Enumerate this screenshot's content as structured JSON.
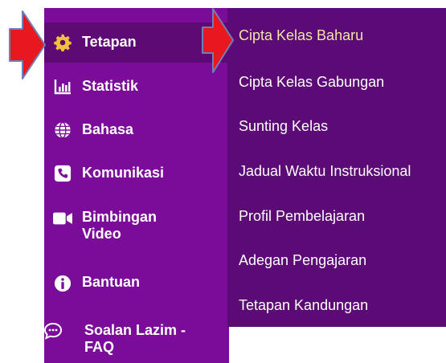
{
  "sidebar": {
    "items": [
      {
        "label": "Tetapan",
        "icon": "gear-icon",
        "active": true
      },
      {
        "label": "Statistik",
        "icon": "bar-chart-icon"
      },
      {
        "label": "Bahasa",
        "icon": "globe-icon"
      },
      {
        "label": "Komunikasi",
        "icon": "phone-icon"
      },
      {
        "label_line1": "Bimbingan",
        "label_line2": "Video",
        "icon": "video-camera-icon"
      },
      {
        "label": "Bantuan",
        "icon": "info-icon"
      },
      {
        "label_line1": "Soalan Lazim -",
        "label_line2": "FAQ",
        "icon": "chat-bubble-icon"
      }
    ]
  },
  "submenu": {
    "items": [
      {
        "label": "Cipta Kelas Baharu",
        "highlight": true
      },
      {
        "label": "Cipta Kelas Gabungan"
      },
      {
        "label": "Sunting Kelas"
      },
      {
        "label": "Jadual Waktu Instruksional"
      },
      {
        "label": "Profil Pembelajaran"
      },
      {
        "label": "Adegan Pengajaran"
      },
      {
        "label": "Tetapan Kandungan"
      }
    ]
  },
  "colors": {
    "sidebar_bg": "#7b0c99",
    "submenu_bg": "#5c0a76",
    "active_bg": "#5e0a74",
    "highlight_text": "#f2e4a8",
    "arrow_red": "#e8191e",
    "arrow_outline": "#6f7fb8",
    "gear_yellow": "#f0c23c"
  }
}
